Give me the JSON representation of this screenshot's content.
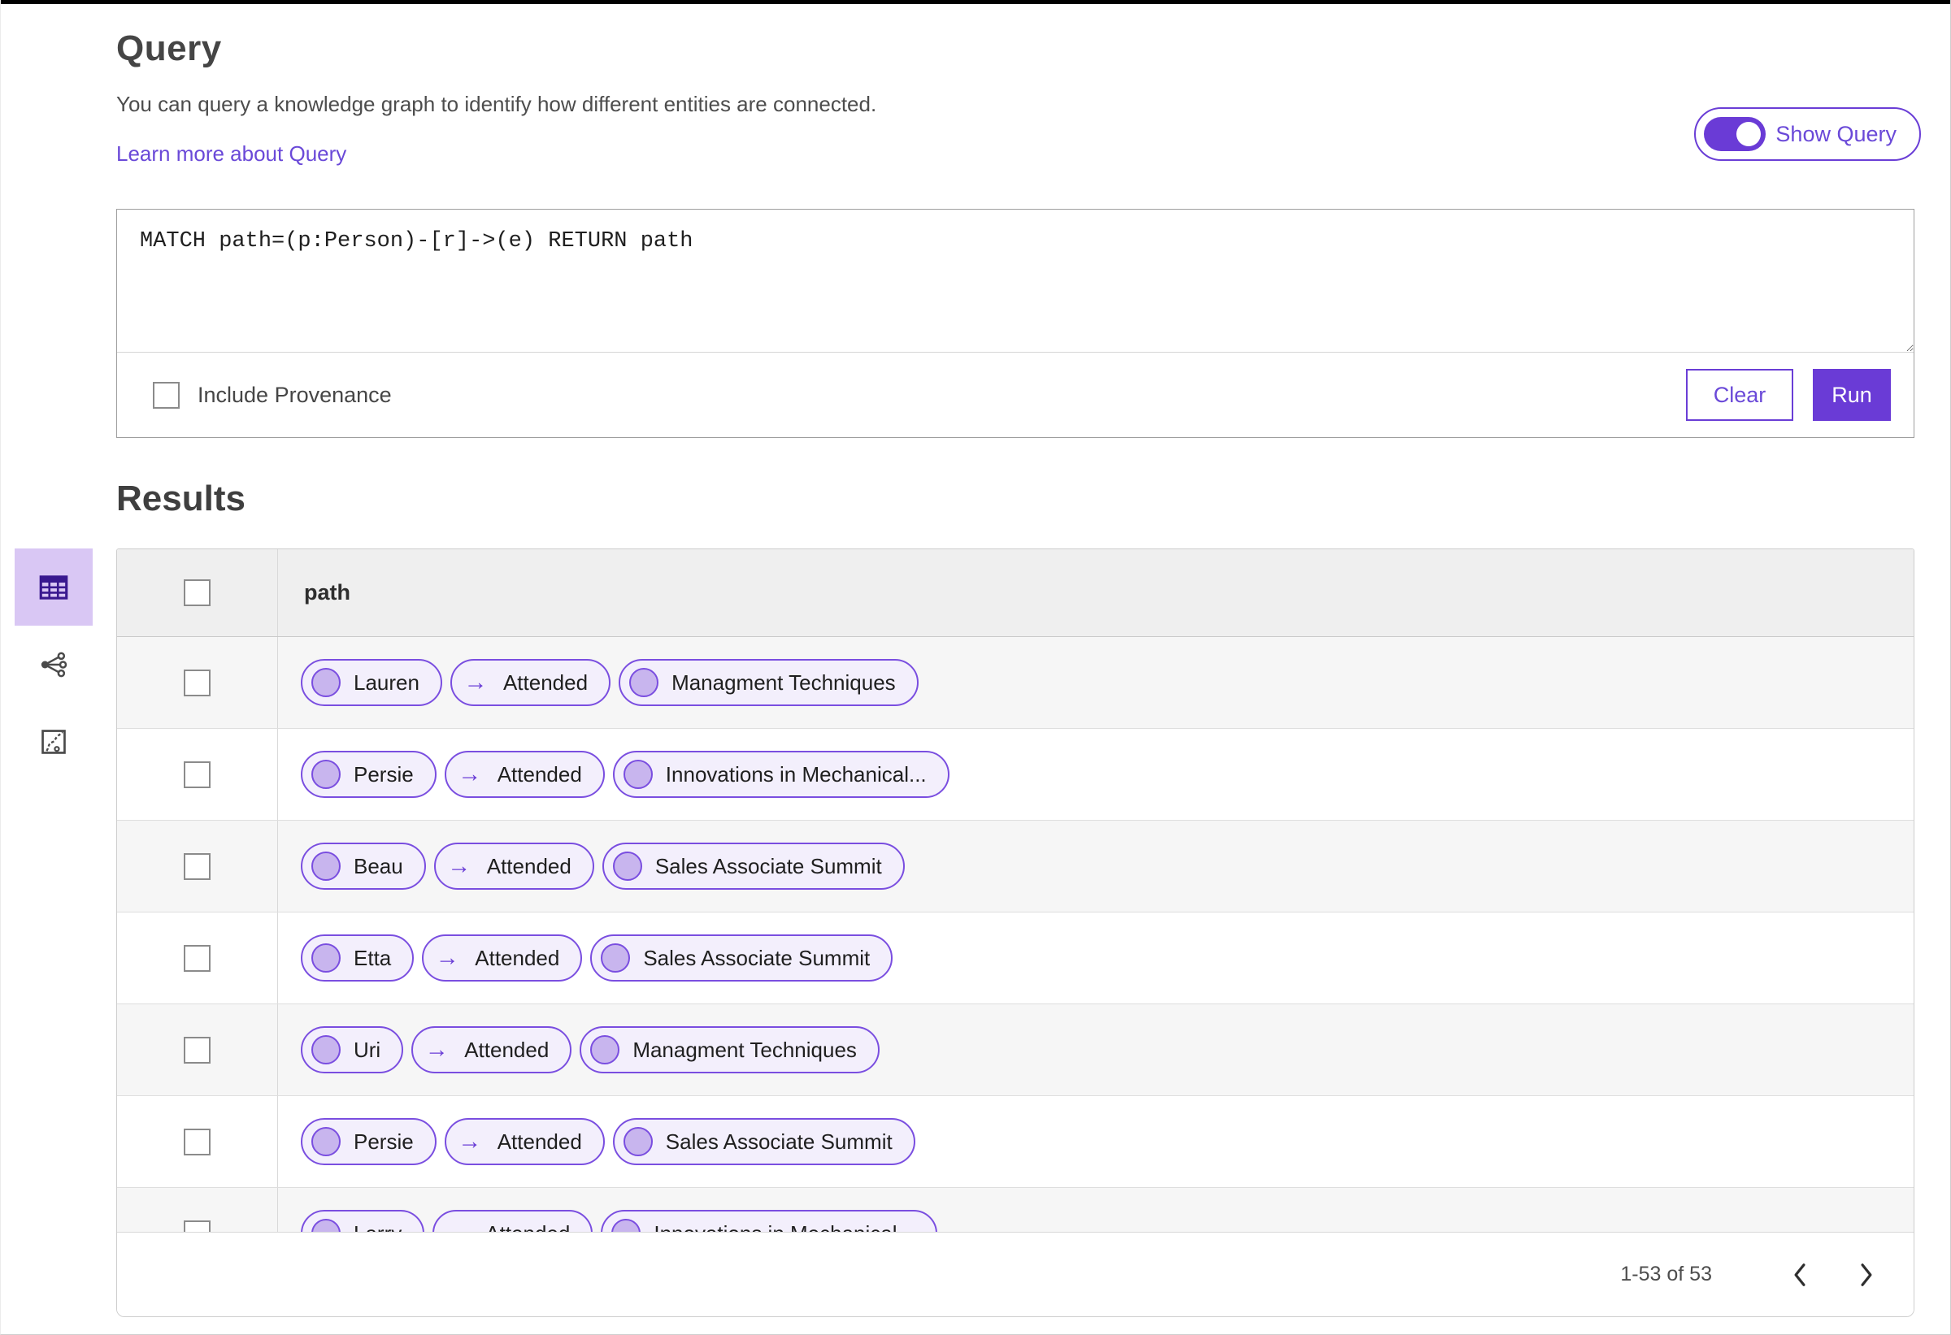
{
  "query": {
    "title": "Query",
    "description": "You can query a knowledge graph to identify how different entities are connected.",
    "learn_more_label": "Learn more about Query",
    "show_query_label": "Show Query",
    "query_text": "MATCH path=(p:Person)-[r]->(e) RETURN path",
    "include_provenance_label": "Include Provenance",
    "clear_label": "Clear",
    "run_label": "Run"
  },
  "results": {
    "title": "Results",
    "view_icons": [
      "table-view-icon",
      "network-graph-icon",
      "chart-view-icon"
    ],
    "selected_view": "table-view-icon",
    "table": {
      "column_header": "path",
      "relation_arrow": "→",
      "rows": [
        {
          "source": "Lauren",
          "relation": "Attended",
          "target": "Managment Techniques"
        },
        {
          "source": "Persie",
          "relation": "Attended",
          "target": "Innovations in Mechanical..."
        },
        {
          "source": "Beau",
          "relation": "Attended",
          "target": "Sales Associate Summit"
        },
        {
          "source": "Etta",
          "relation": "Attended",
          "target": "Sales Associate Summit"
        },
        {
          "source": "Uri",
          "relation": "Attended",
          "target": "Managment Techniques"
        },
        {
          "source": "Persie",
          "relation": "Attended",
          "target": "Sales Associate Summit"
        },
        {
          "source": "Larry",
          "relation": "Attended",
          "target": "Innovations in Mechanical..."
        }
      ]
    },
    "pagination": {
      "range_label": "1-53 of 53"
    }
  },
  "colors": {
    "accent": "#6a3bd6",
    "pill_border": "#7a4ee0",
    "pill_background": "#f3effc",
    "node_fill": "#c8b5ee",
    "selected_view_background": "#d9c7f4",
    "selected_view_icon": "#39188f"
  }
}
